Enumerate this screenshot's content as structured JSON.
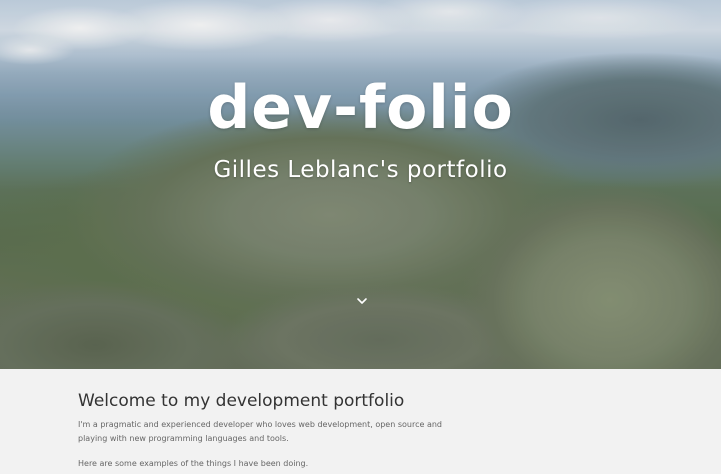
{
  "hero": {
    "title": "dev-folio",
    "subtitle": "Gilles Leblanc's portfolio",
    "scroll_icon": "chevron-down-icon"
  },
  "content": {
    "heading": "Welcome to my development portfolio",
    "intro": "I'm a pragmatic and experienced developer who loves web development, open source and playing with new programming languages and tools.",
    "examples": "Here are some examples of the things I have been doing."
  },
  "colors": {
    "hero_text": "#ffffff",
    "content_bg": "#f2f2f2",
    "heading": "#333333",
    "body_text": "#666666"
  }
}
